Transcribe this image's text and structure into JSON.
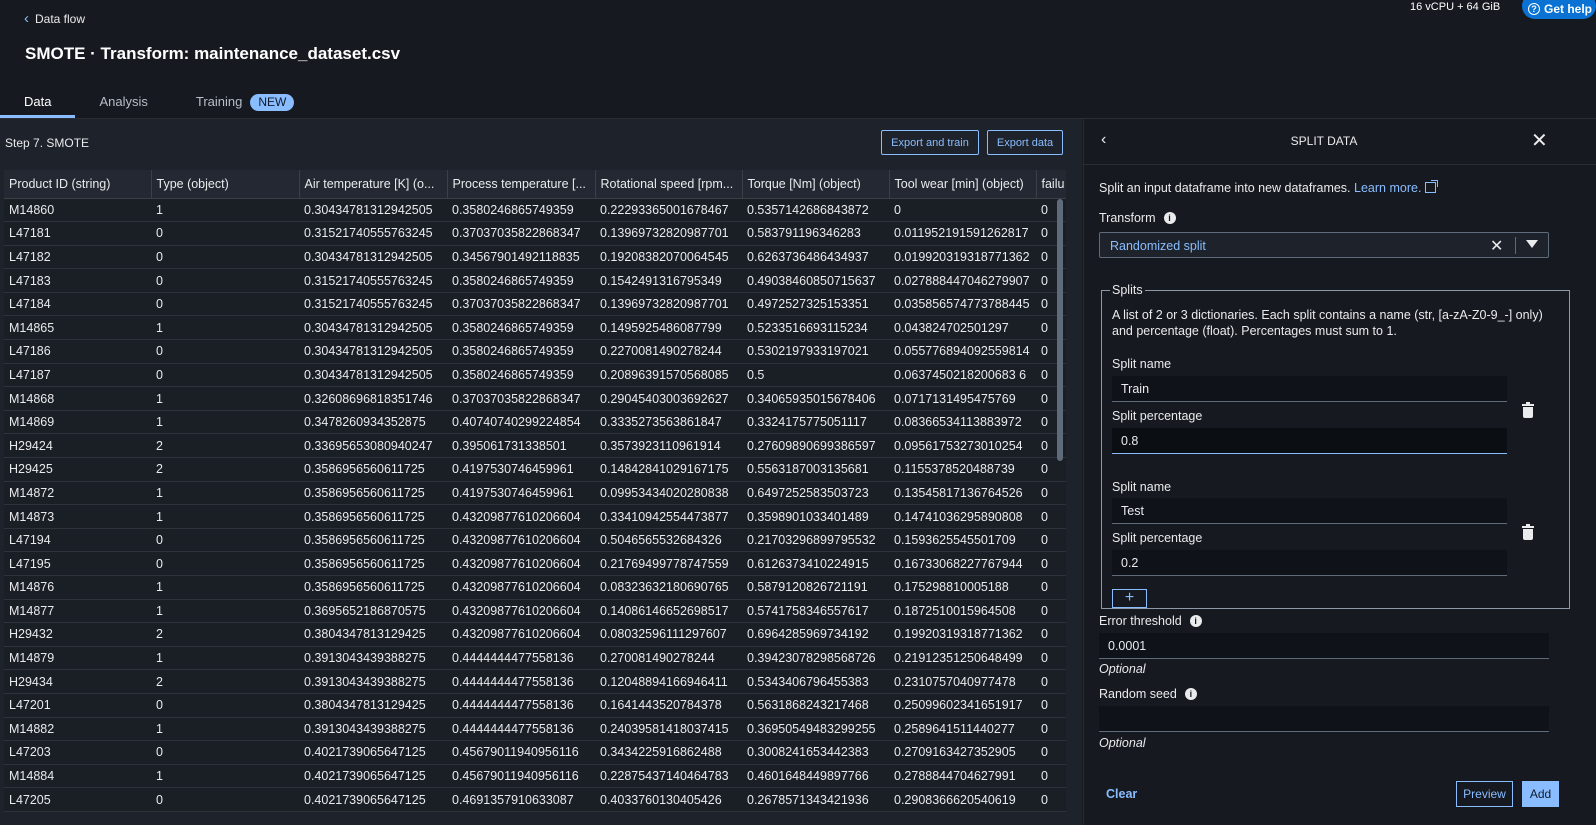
{
  "header": {
    "back_label": "Data flow",
    "title": "SMOTE · Transform: maintenance_dataset.csv",
    "resources": "16 vCPU + 64 GiB",
    "help_label": "Get help"
  },
  "tabs": [
    {
      "label": "Data"
    },
    {
      "label": "Analysis"
    },
    {
      "label": "Training",
      "badge": "NEW"
    }
  ],
  "data_view": {
    "step_title": "Step 7. SMOTE",
    "export_train_label": "Export and train",
    "export_data_label": "Export data",
    "columns": [
      "Product ID (string)",
      "Type (object)",
      "Air temperature [K] (o...",
      "Process temperature [...",
      "Rotational speed [rpm...",
      "Torque [Nm] (object)",
      "Tool wear [min] (object)",
      "failu"
    ],
    "rows": [
      [
        "M14860",
        "1",
        "0.30434781312942505",
        "0.3580246865749359",
        "0.22293365001678467",
        "0.5357142686843872",
        "0",
        "0"
      ],
      [
        "L47181",
        "0",
        "0.31521740555763245",
        "0.37037035822868347",
        "0.13969732820987701",
        "0.583791196346283",
        "0.011952191591262817",
        "0"
      ],
      [
        "L47182",
        "0",
        "0.30434781312942505",
        "0.34567901492118835",
        "0.19208382070064545",
        "0.6263736486434937",
        "0.019920319318771362",
        "0"
      ],
      [
        "L47183",
        "0",
        "0.31521740555763245",
        "0.3580246865749359",
        "0.1542491316795349",
        "0.49038460850715637",
        "0.027888447046279907",
        "0"
      ],
      [
        "L47184",
        "0",
        "0.31521740555763245",
        "0.37037035822868347",
        "0.13969732820987701",
        "0.4972527325153351",
        "0.035856574773788445",
        "0"
      ],
      [
        "M14865",
        "1",
        "0.30434781312942505",
        "0.3580246865749359",
        "0.1495925486087799",
        "0.5233516693115234",
        "0.043824702501297",
        "0"
      ],
      [
        "L47186",
        "0",
        "0.30434781312942505",
        "0.3580246865749359",
        "0.2270081490278244",
        "0.5302197933197021",
        "0.055776894092559814",
        "0"
      ],
      [
        "L47187",
        "0",
        "0.30434781312942505",
        "0.3580246865749359",
        "0.20896391570568085",
        "0.5",
        "0.0637450218200683 6",
        "0"
      ],
      [
        "M14868",
        "1",
        "0.32608696818351746",
        "0.37037035822868347",
        "0.29045403003692627",
        "0.34065935015678406",
        "0.0717131495475769",
        "0"
      ],
      [
        "M14869",
        "1",
        "0.3478260934352875",
        "0.40740740299224854",
        "0.3335273563861847",
        "0.3324175775051117",
        "0.08366534113883972",
        "0"
      ],
      [
        "H29424",
        "2",
        "0.33695653080940247",
        "0.395061731338501",
        "0.3573923110961914",
        "0.27609890699386597",
        "0.09561753273010254",
        "0"
      ],
      [
        "H29425",
        "2",
        "0.3586956560611725",
        "0.4197530746459961",
        "0.14842841029167175",
        "0.5563187003135681",
        "0.1155378520488739",
        "0"
      ],
      [
        "M14872",
        "1",
        "0.3586956560611725",
        "0.4197530746459961",
        "0.09953434020280838",
        "0.6497252583503723",
        "0.13545817136764526",
        "0"
      ],
      [
        "M14873",
        "1",
        "0.3586956560611725",
        "0.43209877610206604",
        "0.33410942554473877",
        "0.3598901033401489",
        "0.14741036295890808",
        "0"
      ],
      [
        "L47194",
        "0",
        "0.3586956560611725",
        "0.43209877610206604",
        "0.5046565532684326",
        "0.21703296899795532",
        "0.1593625545501709",
        "0"
      ],
      [
        "L47195",
        "0",
        "0.3586956560611725",
        "0.43209877610206604",
        "0.21769499778747559",
        "0.6126373410224915",
        "0.16733068227767944",
        "0"
      ],
      [
        "M14876",
        "1",
        "0.3586956560611725",
        "0.43209877610206604",
        "0.08323632180690765",
        "0.5879120826721191",
        "0.175298810005188",
        "0"
      ],
      [
        "M14877",
        "1",
        "0.3695652186870575",
        "0.43209877610206604",
        "0.14086146652698517",
        "0.5741758346557617",
        "0.1872510015964508",
        "0"
      ],
      [
        "H29432",
        "2",
        "0.3804347813129425",
        "0.43209877610206604",
        "0.08032596111297607",
        "0.6964285969734192",
        "0.19920319318771362",
        "0"
      ],
      [
        "M14879",
        "1",
        "0.3913043439388275",
        "0.4444444477558136",
        "0.270081490278244",
        "0.39423078298568726",
        "0.21912351250648499",
        "0"
      ],
      [
        "H29434",
        "2",
        "0.3913043439388275",
        "0.4444444477558136",
        "0.12048894166946411",
        "0.5343406796455383",
        "0.2310757040977478",
        "0"
      ],
      [
        "L47201",
        "0",
        "0.3804347813129425",
        "0.4444444477558136",
        "0.1641443520784378",
        "0.5631868243217468",
        "0.25099602341651917",
        "0"
      ],
      [
        "M14882",
        "1",
        "0.3913043439388275",
        "0.4444444477558136",
        "0.24039581418037415",
        "0.36950549483299255",
        "0.2589641511440277",
        "0"
      ],
      [
        "L47203",
        "0",
        "0.4021739065647125",
        "0.45679011940956116",
        "0.3434225916862488",
        "0.3008241653442383",
        "0.2709163427352905",
        "0"
      ],
      [
        "M14884",
        "1",
        "0.4021739065647125",
        "0.45679011940956116",
        "0.22875437140464783",
        "0.4601648449897766",
        "0.2788844704627991",
        "0"
      ],
      [
        "L47205",
        "0",
        "0.4021739065647125",
        "0.4691357910633087",
        "0.4033760130405426",
        "0.2678571343421936",
        "0.2908366620540619",
        "0"
      ]
    ]
  },
  "panel": {
    "title": "SPLIT DATA",
    "description": "Split an input dataframe into new dataframes.",
    "learn_more": "Learn more.",
    "transform_label": "Transform",
    "transform_value": "Randomized split",
    "splits_legend": "Splits",
    "splits_description": "A list of 2 or 3 dictionaries. Each split contains a name (str, [a-zA-Z0-9_-] only) and percentage (float). Percentages must sum to 1.",
    "splits": [
      {
        "name_label": "Split name",
        "name": "Train",
        "pct_label": "Split percentage",
        "pct": "0.8"
      },
      {
        "name_label": "Split name",
        "name": "Test",
        "pct_label": "Split percentage",
        "pct": "0.2"
      }
    ],
    "add_split": "+",
    "error_threshold_label": "Error threshold",
    "error_threshold_value": "0.0001",
    "optional_label": "Optional",
    "random_seed_label": "Random seed",
    "random_seed_value": "",
    "clear_label": "Clear",
    "preview_label": "Preview",
    "add_label": "Add"
  },
  "colors": {
    "background": "#16191f",
    "accent": "#89bdff",
    "primary_button": "#0972d3"
  }
}
